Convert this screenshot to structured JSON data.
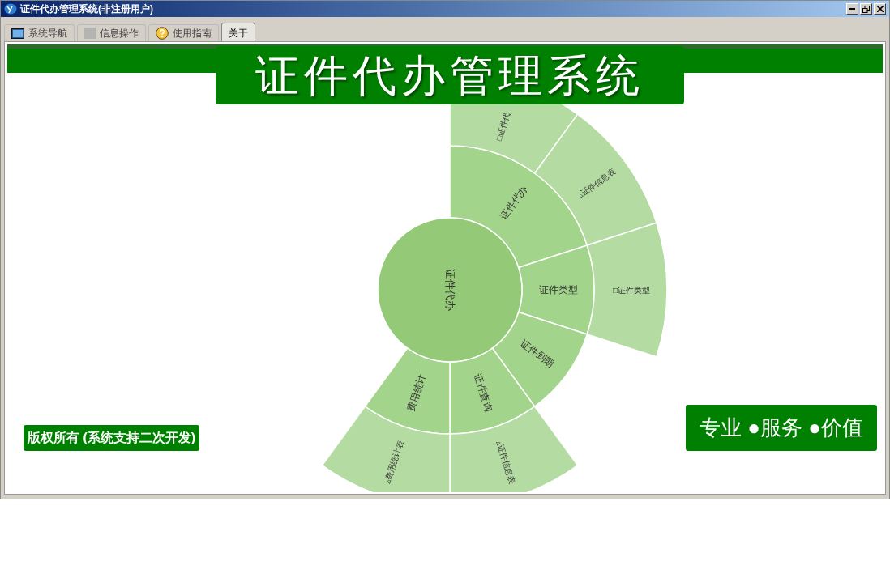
{
  "window": {
    "title": "证件代办管理系统(非注册用户)"
  },
  "tabs": [
    {
      "label": "系统导航",
      "kind": "monitor",
      "selected": false
    },
    {
      "label": "信息操作",
      "kind": "grid",
      "selected": false
    },
    {
      "label": "使用指南",
      "kind": "help",
      "selected": false
    },
    {
      "label": "关于",
      "kind": "none",
      "selected": true
    }
  ],
  "banner": {
    "title": "证件代办管理系统"
  },
  "sunburst": {
    "center": "证件代办",
    "children": [
      {
        "label": "证件代办",
        "children": [
          {
            "label": "□证件代"
          },
          {
            "label": "▵证件信息表"
          }
        ]
      },
      {
        "label": "证件类型",
        "children": [
          {
            "label": "□证件类型"
          }
        ]
      },
      {
        "label": "证件到期"
      },
      {
        "label": "证件查询",
        "children": [
          {
            "label": "▵证件信息表"
          }
        ]
      },
      {
        "label": "费用统计",
        "children": [
          {
            "label": "▵费用统计表"
          }
        ]
      }
    ]
  },
  "copyright": "版权所有 (系统支持二次开发)",
  "slogan": "专业 ●服务 ●价值"
}
